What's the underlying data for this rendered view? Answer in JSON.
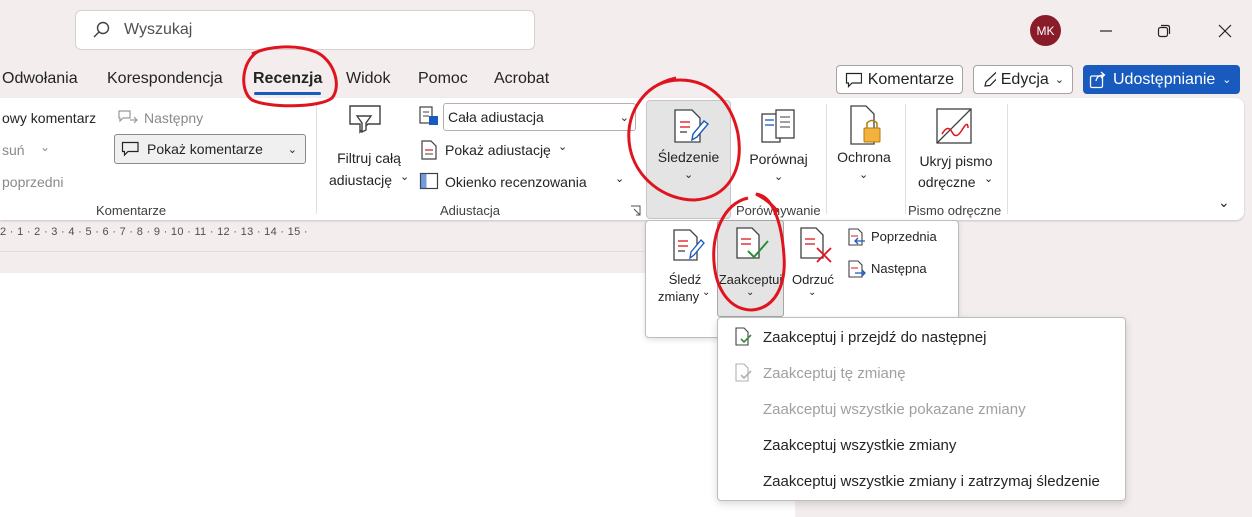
{
  "search": {
    "placeholder": "Wyszukaj"
  },
  "account": {
    "initials": "MK"
  },
  "tabs": [
    "Odwołania",
    "Korespondencja",
    "Recenzja",
    "Widok",
    "Pomoc",
    "Acrobat"
  ],
  "header_buttons": {
    "comments": "Komentarze",
    "editing": "Edycja",
    "share": "Udostępnianie"
  },
  "ribbon": {
    "comments_group": {
      "new_comment": "owy komentarz",
      "delete": "suń",
      "previous": "poprzedni",
      "next": "Następny",
      "show_comments": "Pokaż komentarze",
      "label": "Komentarze"
    },
    "markup_group": {
      "filter_all_line1": "Filtruj całą",
      "filter_all_line2": "adiustację",
      "markup_select": "Cała adiustacja",
      "show_markup": "Pokaż adiustację",
      "reviewing_pane": "Okienko recenzowania",
      "label": "Adiustacja"
    },
    "tracking": {
      "label": "Śledzenie"
    },
    "compare": {
      "label": "Porównaj",
      "group_label": "Porównywanie"
    },
    "protect": {
      "label": "Ochrona"
    },
    "ink": {
      "line1": "Ukryj pismo",
      "line2": "odręczne",
      "group_label": "Pismo odręczne"
    }
  },
  "ruler": {
    "text": "2 · 1 · 2 · 3 · 4 · 5 · 6 · 7 · 8 · 9 · 10 · 11 · 12 · 13 · 14 · 15 ·"
  },
  "tracking_panel": {
    "track_changes_line1": "Śledź",
    "track_changes_line2": "zmiany",
    "accept": "Zaakceptuj",
    "reject": "Odrzuć",
    "previous": "Poprzednia",
    "next": "Następna"
  },
  "accept_menu": {
    "items": [
      {
        "label": "Zaakceptuj i przejdź do następnej",
        "enabled": true
      },
      {
        "label": "Zaakceptuj tę zmianę",
        "enabled": false
      },
      {
        "label": "Zaakceptuj wszystkie pokazane zmiany",
        "enabled": false
      },
      {
        "label": "Zaakceptuj wszystkie zmiany",
        "enabled": true
      },
      {
        "label": "Zaakceptuj wszystkie zmiany i zatrzymaj śledzenie",
        "enabled": true
      }
    ]
  },
  "colors": {
    "accent": "#185abd",
    "annotation": "#e0141e",
    "avatar": "#8a1c2a"
  }
}
